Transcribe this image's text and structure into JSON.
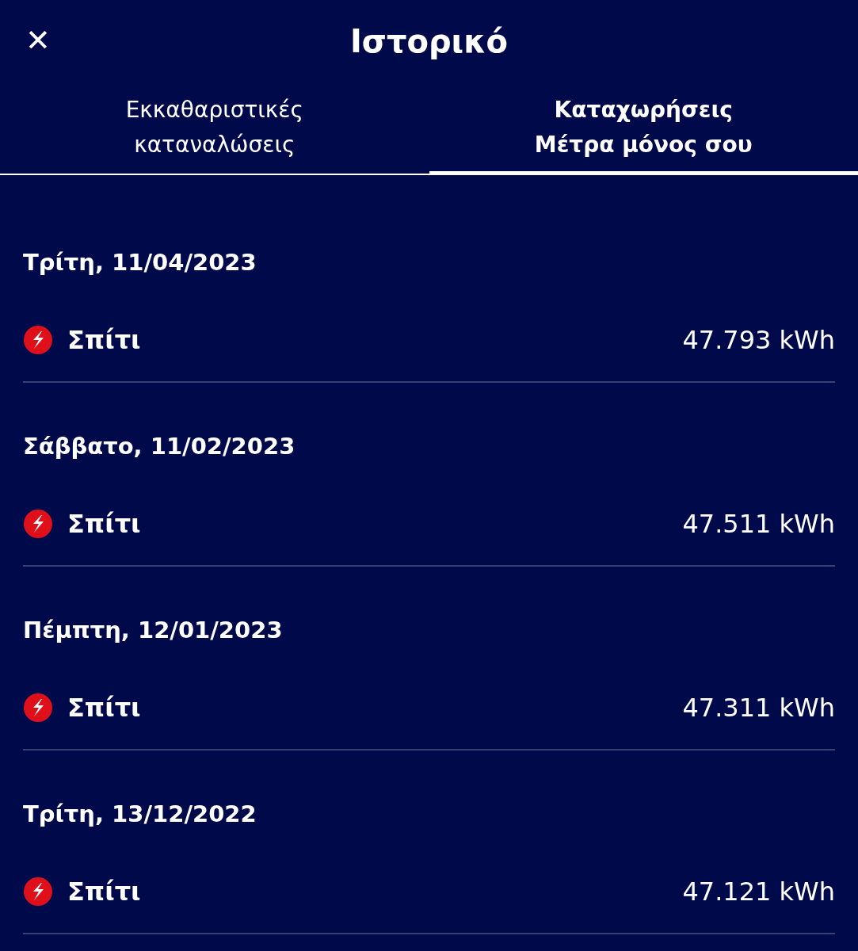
{
  "header": {
    "title": "Ιστορικό",
    "close": "✕"
  },
  "tabs": [
    {
      "label": "Εκκαθαριστικές\nκαταναλώσεις",
      "selected": false
    },
    {
      "label": "Καταχωρήσεις\nΜέτρα μόνος σου",
      "selected": true
    }
  ],
  "entries": [
    {
      "date": "Τρίτη, 11/04/2023",
      "place": "Σπίτι",
      "reading": "47.793 kWh"
    },
    {
      "date": "Σάββατο, 11/02/2023",
      "place": "Σπίτι",
      "reading": "47.511 kWh"
    },
    {
      "date": "Πέμπτη, 12/01/2023",
      "place": "Σπίτι",
      "reading": "47.311 kWh"
    },
    {
      "date": "Τρίτη, 13/12/2022",
      "place": "Σπίτι",
      "reading": "47.121 kWh"
    }
  ]
}
